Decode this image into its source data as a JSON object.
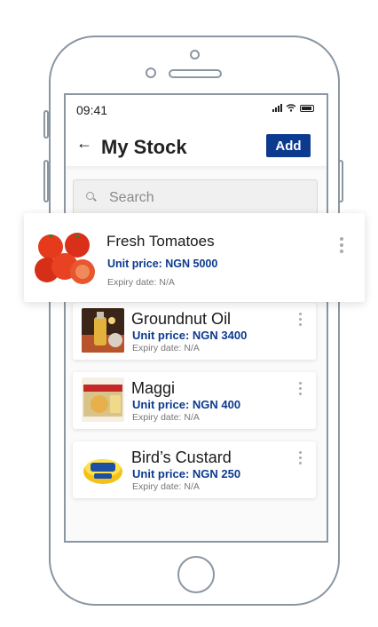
{
  "status_bar": {
    "time": "09:41"
  },
  "header": {
    "title": "My Stock",
    "back_label": "←",
    "add_label": "Add"
  },
  "search": {
    "placeholder": "Search"
  },
  "items": [
    {
      "name": "Fresh Tomatoes",
      "price": "Unit price: NGN 5000",
      "expiry": "Expiry date: N/A"
    },
    {
      "name": "Groundnut Oil",
      "price": "Unit price: NGN 3400",
      "expiry": "Expiry date: N/A"
    },
    {
      "name": "Maggi",
      "price": "Unit price: NGN 400",
      "expiry": "Expiry date: N/A"
    },
    {
      "name": "Bird’s Custard",
      "price": "Unit price: NGN 250",
      "expiry": "Expiry date: N/A"
    }
  ],
  "colors": {
    "accent": "#0b3a8f",
    "frame": "#8b96a3"
  }
}
